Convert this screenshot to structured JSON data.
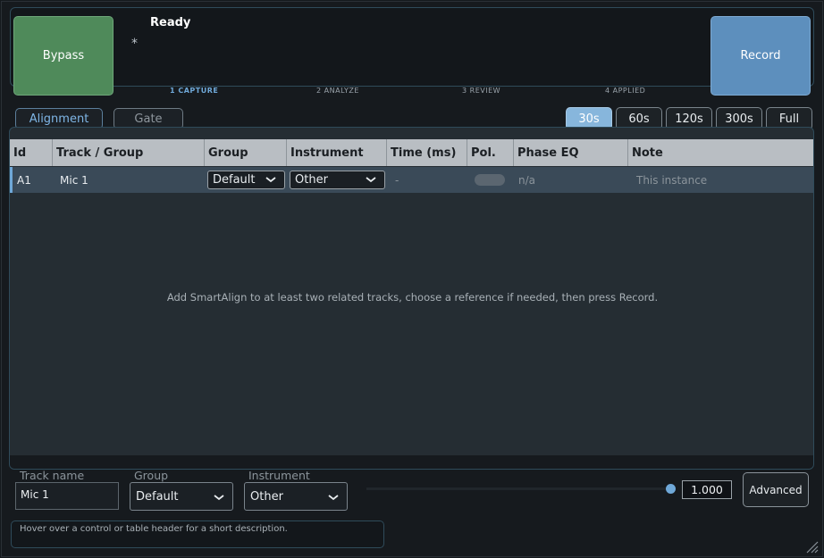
{
  "header": {
    "bypass_label": "Bypass",
    "record_label": "Record",
    "status_title": "Ready",
    "status_star": "*",
    "steps": [
      {
        "label": "1  CAPTURE",
        "active": true
      },
      {
        "label": "2  ANALYZE",
        "active": false
      },
      {
        "label": "3  REVIEW",
        "active": false
      },
      {
        "label": "4  APPLIED",
        "active": false
      }
    ]
  },
  "modes": {
    "alignment": "Alignment",
    "gate": "Gate"
  },
  "durations": [
    "30s",
    "60s",
    "120s",
    "300s",
    "Full"
  ],
  "selected_duration": "30s",
  "table": {
    "headers": [
      "Id",
      "Track / Group",
      "Group",
      "Instrument",
      "Time (ms)",
      "Pol.",
      "Phase EQ",
      "Note"
    ],
    "row": {
      "id": "A1",
      "track": "Mic 1",
      "group": "Default",
      "instrument": "Other",
      "time": "-",
      "phase_eq": "n/a",
      "note": "This instance"
    },
    "empty_message": "Add SmartAlign to at least two related tracks, choose a reference if needed, then press Record."
  },
  "footer": {
    "track_name_label": "Track name",
    "track_name_value": "Mic 1",
    "group_label": "Group",
    "group_value": "Default",
    "instrument_label": "Instrument",
    "instrument_value": "Other",
    "slider_value": "1.000",
    "advanced_label": "Advanced",
    "hint": "Hover over a control or table header for a short description."
  },
  "colors": {
    "bypass": "#4f8a5a",
    "record": "#5d8fbd",
    "accent": "#6fa8d8",
    "selected_duration": "#87b6dc"
  }
}
